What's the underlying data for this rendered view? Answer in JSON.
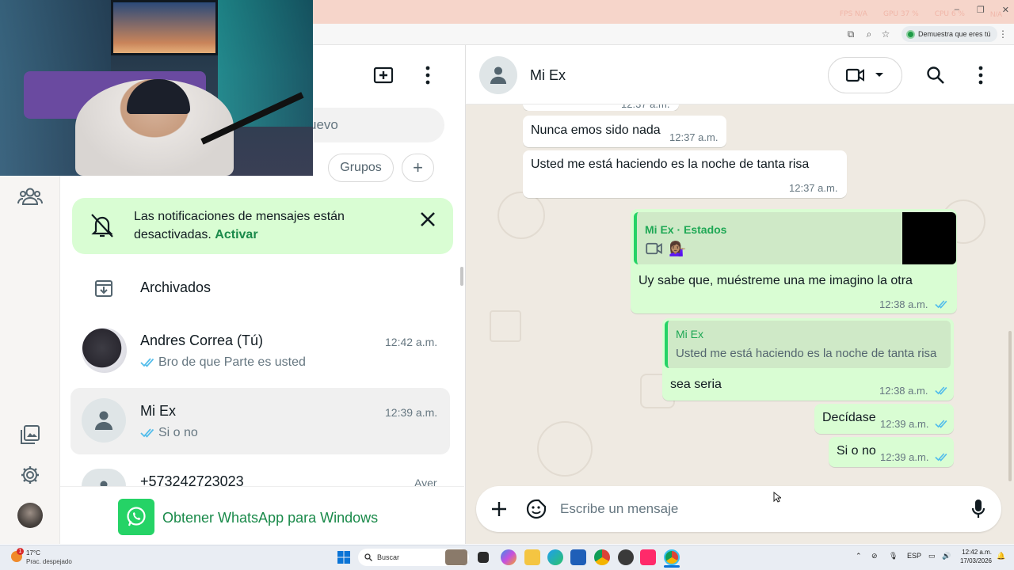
{
  "overlay": {
    "fps": "FPS  N/A",
    "gpu": "GPU  37 %",
    "cpu": "CPU  6 %",
    "na": "N/A"
  },
  "browser": {
    "verify_label": "Demuestra que eres tú"
  },
  "list": {
    "search_placeholder": "uevo",
    "filters": [
      "Grupos"
    ],
    "notification": {
      "text": "Las notificaciones de mensajes están desactivadas.",
      "link": "Activar"
    },
    "archived": "Archivados",
    "chats": [
      {
        "name": "Andres Correa (Tú)",
        "time": "12:42 a.m.",
        "preview": "Bro de que Parte es usted"
      },
      {
        "name": "Mi Ex",
        "time": "12:39 a.m.",
        "preview": "Si o no"
      },
      {
        "name": "+573242723023",
        "time": "Ayer"
      }
    ],
    "get_app": "Obtener WhatsApp para Windows"
  },
  "chat": {
    "contact_name": "Mi Ex",
    "top_partial_time": "12:37 a.m.",
    "messages": [
      {
        "dir": "in",
        "text": "Nunca emos sido nada",
        "time": "12:37 a.m."
      },
      {
        "dir": "in",
        "text": "Usted me está haciendo es la noche de tanta risa",
        "time": "12:37 a.m."
      },
      {
        "dir": "out",
        "quote_author": "Mi Ex · Estados",
        "quote_emoji": "💁🏽‍♀️",
        "text": "Uy sabe que, muéstreme una me imagino la otra",
        "time": "12:38 a.m."
      },
      {
        "dir": "out",
        "quote_author": "Mi Ex",
        "quote_text": "Usted me está haciendo es la noche de tanta risa",
        "text": "sea seria",
        "time": "12:38 a.m."
      },
      {
        "dir": "out",
        "text": "Decídase",
        "time": "12:39 a.m."
      },
      {
        "dir": "out",
        "text": "Si o no",
        "time": "12:39 a.m."
      }
    ],
    "composer_placeholder": "Escribe un mensaje"
  },
  "taskbar": {
    "weather_temp": "17°C",
    "weather_desc": "Prac. despejado",
    "weather_badge": "1",
    "search_label": "Buscar",
    "lang": "ESP",
    "time": "12:42 a.m.",
    "date": "17/03/2026"
  },
  "colors": {
    "accent": "#25d366",
    "bubble_out": "#d9fdd3",
    "chat_bg": "#efeae2",
    "read_ticks": "#53bdeb"
  }
}
